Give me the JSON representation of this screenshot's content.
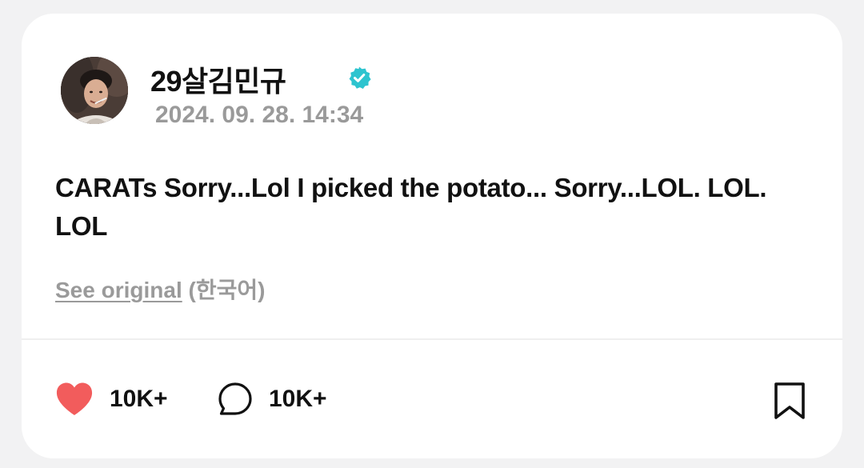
{
  "post": {
    "author": {
      "name": "29살김민규",
      "verified": true,
      "verified_color": "#2ec4cf",
      "avatar_icon": "profile-photo"
    },
    "timestamp": "2024. 09. 28. 14:34",
    "text": "CARATs Sorry...Lol I picked the potato... Sorry...LOL. LOL. LOL",
    "translation": {
      "see_original_label": "See original",
      "language_label": "(한국어)"
    }
  },
  "actions": {
    "like": {
      "icon": "heart-icon",
      "count": "10K+",
      "liked": true,
      "color": "#f25c5c"
    },
    "comment": {
      "icon": "comment-bubble-icon",
      "count": "10K+"
    },
    "bookmark": {
      "icon": "bookmark-icon"
    }
  }
}
